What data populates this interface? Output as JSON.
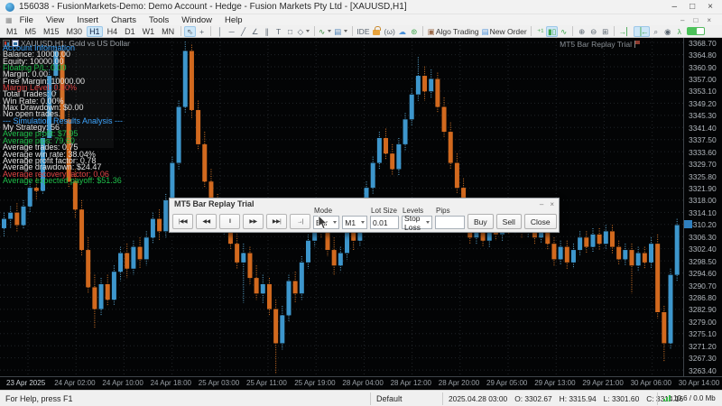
{
  "window": {
    "title": "156038 - FusionMarkets-Demo: Demo Account - Hedge - Fusion Markets Pty Ltd - [XAUUSD,H1]",
    "controls": {
      "minimize": "–",
      "maximize": "□",
      "close": "×"
    }
  },
  "menu": {
    "icon": "▦",
    "items": [
      "File",
      "View",
      "Insert",
      "Charts",
      "Tools",
      "Window",
      "Help"
    ]
  },
  "toolbar": {
    "timeframes": [
      "M1",
      "M5",
      "M15",
      "M30",
      "H1",
      "H4",
      "D1",
      "W1",
      "MN"
    ],
    "active_timeframe": "H1",
    "items": [
      {
        "type": "sep"
      },
      {
        "name": "cursor-tool-button",
        "glyph": "⇖",
        "active": true
      },
      {
        "name": "crosshair-tool-button",
        "glyph": "+"
      },
      {
        "type": "sep"
      },
      {
        "name": "vertical-line-tool-button",
        "glyph": "│"
      },
      {
        "name": "horizontal-line-tool-button",
        "glyph": "─"
      },
      {
        "name": "trendline-tool-button",
        "glyph": "╱"
      },
      {
        "name": "angle-trendline-tool-button",
        "glyph": "∠"
      },
      {
        "name": "equidistant-channel-tool-button",
        "glyph": "∥"
      },
      {
        "name": "text-tool-button",
        "glyph": "T"
      },
      {
        "name": "rectangle-tool-button",
        "glyph": "□"
      },
      {
        "name": "shapes-menu-button",
        "glyph": "◇",
        "caret": true
      },
      {
        "type": "sep"
      },
      {
        "name": "indicators-menu-button",
        "glyph": "∿",
        "color": "#3a8c3f",
        "caret": true
      },
      {
        "name": "templates-menu-button",
        "glyph": "▤",
        "color": "#4a7fb5",
        "caret": true
      },
      {
        "type": "sep"
      },
      {
        "name": "ide-button",
        "glyph": "IDE"
      },
      {
        "name": "lock-icon",
        "css": "lockicon"
      },
      {
        "name": "virtual-hosting-button",
        "glyph": "(ω)"
      },
      {
        "name": "cloud-icon-button",
        "glyph": "☁",
        "color": "#4a90d9"
      },
      {
        "name": "community-icon-button",
        "glyph": "⊛",
        "color": "#3da54a"
      },
      {
        "type": "sep"
      },
      {
        "name": "algo-trading-button",
        "glyph": "▣",
        "color": "#9a6a4a",
        "label": "Algo Trading"
      },
      {
        "name": "new-order-button",
        "glyph": "▤",
        "color": "#4a90d9",
        "label": "New Order"
      },
      {
        "type": "sep"
      },
      {
        "name": "tick-chart-button",
        "glyph": "⁺¹",
        "color": "#3da54a"
      },
      {
        "name": "candle-chart-button",
        "glyph": "▮▯",
        "color": "#3da54a",
        "active": true
      },
      {
        "name": "line-chart-button",
        "glyph": "∿",
        "color": "#3da54a"
      },
      {
        "type": "sep"
      },
      {
        "name": "zoom-in-button",
        "glyph": "⊕"
      },
      {
        "name": "zoom-out-button",
        "glyph": "⊖"
      },
      {
        "name": "tile-windows-button",
        "glyph": "⊞"
      },
      {
        "type": "sep"
      },
      {
        "name": "auto-scroll-button",
        "glyph": "→▏",
        "color": "#3da54a"
      },
      {
        "name": "chart-shift-button",
        "glyph": "▕←",
        "color": "#3da54a",
        "active": true
      },
      {
        "name": "search-icon-button",
        "glyph": "⌕"
      },
      {
        "name": "help-about-button",
        "glyph": "◉"
      },
      {
        "name": "hotkey-walker-button",
        "glyph": "λ",
        "color": "#3da54a"
      },
      {
        "name": "replay-toggle",
        "css": "toggle"
      }
    ]
  },
  "chart": {
    "symbol_label": "XAUUSD,H1:  Gold vs US Dollar",
    "indicator_label": "MT5 Bar Replay Trial",
    "price_marker": "3310.20",
    "colors": {
      "up": "#3d96cc",
      "up_wick": "#5fb0dd",
      "down": "#d2691e",
      "down_wick": "#e07b28",
      "grid": "#212529",
      "accent": "#2f7fbe"
    }
  },
  "overlay": {
    "colors": {
      "w": "#e2e2e2",
      "g": "#1fbf4a",
      "r": "#e04545",
      "b": "#3ea6ff"
    },
    "lines": [
      {
        "t": "Account Information",
        "c": "b"
      },
      {
        "t": "Balance: 10000.00",
        "c": "w"
      },
      {
        "t": "Equity: 10000.00",
        "c": "w"
      },
      {
        "t": "Floating P/L: 0.00",
        "c": "g"
      },
      {
        "t": "Margin: 0.00",
        "c": "w"
      },
      {
        "t": "Free Margin: 10000.00",
        "c": "w"
      },
      {
        "t": "Margin Level: 0.00%",
        "c": "r"
      },
      {
        "t": "Total Trades: 0",
        "c": "w"
      },
      {
        "t": "Win Rate: 0.00%",
        "c": "w"
      },
      {
        "t": "Max Drawdown: $0.00",
        "c": "w"
      },
      {
        "t": "No open trades.",
        "c": "w"
      },
      {
        "t": "--- Simulation Results Analysis ---",
        "c": "b"
      },
      {
        "t": "My Strategy: 56",
        "c": "w"
      },
      {
        "t": "Average profit: $7.95",
        "c": "g"
      },
      {
        "t": "Average pips: 79.60",
        "c": "g"
      },
      {
        "t": "Average trades: 0.75",
        "c": "w"
      },
      {
        "t": "Average win rate: 38.04%",
        "c": "w"
      },
      {
        "t": "Average profit factor: 0.78",
        "c": "w"
      },
      {
        "t": "Average drawdown: $24.47",
        "c": "w"
      },
      {
        "t": "Average recovery factor: 0.06",
        "c": "r"
      },
      {
        "t": "Average expected payoff: $51.36",
        "c": "g"
      }
    ]
  },
  "chart_data": {
    "type": "candlestick",
    "symbol": "XAUUSD",
    "timeframe": "H1",
    "grid": true,
    "ylim": [
      3263.4,
      3368.7
    ],
    "render_ylim": [
      3261.4,
      3370.2
    ],
    "y_ticks": [
      "3368.70",
      "3364.80",
      "3360.90",
      "3357.00",
      "3353.10",
      "3349.20",
      "3345.30",
      "3341.40",
      "3337.50",
      "3333.60",
      "3329.70",
      "3325.80",
      "3321.90",
      "3318.00",
      "3314.10",
      "3310.20",
      "3306.30",
      "3302.40",
      "3298.50",
      "3294.60",
      "3290.70",
      "3286.80",
      "3282.90",
      "3279.00",
      "3275.10",
      "3271.20",
      "3267.30",
      "3263.40"
    ],
    "x_ticks": [
      "23 Apr 2025",
      "24 Apr 02:00",
      "24 Apr 10:00",
      "24 Apr 18:00",
      "25 Apr 03:00",
      "25 Apr 11:00",
      "25 Apr 19:00",
      "28 Apr 04:00",
      "28 Apr 12:00",
      "28 Apr 20:00",
      "29 Apr 05:00",
      "29 Apr 13:00",
      "29 Apr 21:00",
      "30 Apr 06:00",
      "30 Apr 14:00"
    ],
    "candles": [
      [
        3309,
        3314,
        3306,
        3312
      ],
      [
        3312,
        3316,
        3309,
        3314
      ],
      [
        3314,
        3317,
        3308,
        3310
      ],
      [
        3310,
        3318,
        3309,
        3316
      ],
      [
        3316,
        3324,
        3314,
        3322
      ],
      [
        3322,
        3326,
        3318,
        3321
      ],
      [
        3321,
        3340,
        3320,
        3338
      ],
      [
        3338,
        3360,
        3336,
        3358
      ],
      [
        3358,
        3368,
        3352,
        3366
      ],
      [
        3366,
        3369,
        3342,
        3344
      ],
      [
        3344,
        3348,
        3322,
        3324
      ],
      [
        3324,
        3328,
        3312,
        3315
      ],
      [
        3315,
        3318,
        3300,
        3302
      ],
      [
        3302,
        3306,
        3288,
        3290
      ],
      [
        3290,
        3294,
        3277,
        3283
      ],
      [
        3283,
        3293,
        3281,
        3291
      ],
      [
        3291,
        3294,
        3284,
        3286
      ],
      [
        3286,
        3297,
        3284,
        3295
      ],
      [
        3295,
        3303,
        3292,
        3301
      ],
      [
        3301,
        3304,
        3293,
        3296
      ],
      [
        3296,
        3305,
        3294,
        3303
      ],
      [
        3303,
        3306,
        3296,
        3299
      ],
      [
        3299,
        3308,
        3297,
        3306
      ],
      [
        3306,
        3314,
        3304,
        3312
      ],
      [
        3312,
        3315,
        3305,
        3308
      ],
      [
        3308,
        3320,
        3306,
        3318
      ],
      [
        3318,
        3332,
        3316,
        3330
      ],
      [
        3330,
        3350,
        3328,
        3348
      ],
      [
        3348,
        3369,
        3346,
        3366
      ],
      [
        3366,
        3368,
        3344,
        3347
      ],
      [
        3347,
        3350,
        3334,
        3336
      ],
      [
        3336,
        3340,
        3322,
        3324
      ],
      [
        3324,
        3328,
        3314,
        3316
      ],
      [
        3316,
        3320,
        3308,
        3310
      ],
      [
        3310,
        3316,
        3307,
        3313
      ],
      [
        3313,
        3315,
        3302,
        3304
      ],
      [
        3304,
        3308,
        3296,
        3298
      ],
      [
        3298,
        3304,
        3285,
        3301
      ],
      [
        3301,
        3303,
        3291,
        3293
      ],
      [
        3293,
        3297,
        3286,
        3288
      ],
      [
        3288,
        3294,
        3285,
        3291
      ],
      [
        3291,
        3293,
        3281,
        3283
      ],
      [
        3283,
        3286,
        3262,
        3272
      ],
      [
        3272,
        3284,
        3270,
        3281
      ],
      [
        3281,
        3294,
        3279,
        3292
      ],
      [
        3292,
        3295,
        3285,
        3288
      ],
      [
        3288,
        3300,
        3286,
        3298
      ],
      [
        3298,
        3307,
        3296,
        3305
      ],
      [
        3305,
        3314,
        3303,
        3312
      ],
      [
        3312,
        3315,
        3306,
        3308
      ],
      [
        3308,
        3311,
        3300,
        3302
      ],
      [
        3302,
        3306,
        3294,
        3297
      ],
      [
        3297,
        3303,
        3295,
        3301
      ],
      [
        3301,
        3310,
        3299,
        3308
      ],
      [
        3308,
        3311,
        3302,
        3305
      ],
      [
        3305,
        3316,
        3303,
        3314
      ],
      [
        3314,
        3324,
        3312,
        3322
      ],
      [
        3322,
        3332,
        3320,
        3330
      ],
      [
        3330,
        3340,
        3328,
        3338
      ],
      [
        3338,
        3341,
        3331,
        3333
      ],
      [
        3333,
        3336,
        3326,
        3328
      ],
      [
        3328,
        3338,
        3326,
        3336
      ],
      [
        3336,
        3346,
        3334,
        3344
      ],
      [
        3344,
        3354,
        3342,
        3352
      ],
      [
        3352,
        3364,
        3350,
        3358
      ],
      [
        3358,
        3361,
        3350,
        3353
      ],
      [
        3353,
        3360,
        3351,
        3357
      ],
      [
        3357,
        3359,
        3346,
        3348
      ],
      [
        3348,
        3351,
        3338,
        3340
      ],
      [
        3340,
        3343,
        3328,
        3330
      ],
      [
        3330,
        3333,
        3320,
        3322
      ],
      [
        3322,
        3325,
        3311,
        3313
      ],
      [
        3313,
        3316,
        3304,
        3306
      ],
      [
        3306,
        3313,
        3304,
        3311
      ],
      [
        3311,
        3313,
        3303,
        3305
      ],
      [
        3305,
        3312,
        3303,
        3310
      ],
      [
        3310,
        3313,
        3305,
        3307
      ],
      [
        3307,
        3314,
        3305,
        3312
      ],
      [
        3312,
        3314,
        3307,
        3309
      ],
      [
        3309,
        3315,
        3307,
        3313
      ],
      [
        3313,
        3315,
        3306,
        3308
      ],
      [
        3308,
        3313,
        3306,
        3311
      ],
      [
        3311,
        3313,
        3304,
        3306
      ],
      [
        3306,
        3312,
        3304,
        3310
      ],
      [
        3310,
        3312,
        3302,
        3304
      ],
      [
        3304,
        3306,
        3297,
        3299
      ],
      [
        3299,
        3305,
        3297,
        3303
      ],
      [
        3303,
        3305,
        3296,
        3298
      ],
      [
        3298,
        3304,
        3296,
        3302
      ],
      [
        3302,
        3308,
        3300,
        3306
      ],
      [
        3306,
        3308,
        3301,
        3303
      ],
      [
        3303,
        3309,
        3301,
        3307
      ],
      [
        3307,
        3309,
        3302,
        3304
      ],
      [
        3304,
        3310,
        3302,
        3308
      ],
      [
        3308,
        3310,
        3301,
        3303
      ],
      [
        3303,
        3305,
        3297,
        3299
      ],
      [
        3299,
        3304,
        3297,
        3302
      ],
      [
        3302,
        3304,
        3288,
        3297
      ],
      [
        3297,
        3303,
        3295,
        3301
      ],
      [
        3301,
        3303,
        3296,
        3298
      ],
      [
        3298,
        3306,
        3296,
        3304
      ],
      [
        3304,
        3307,
        3280,
        3282
      ],
      [
        3282,
        3284,
        3266,
        3272
      ],
      [
        3272,
        3296,
        3270,
        3294
      ],
      [
        3294,
        3312,
        3292,
        3310
      ]
    ]
  },
  "dialog": {
    "title": "MT5 Bar Replay Trial",
    "minimize": "–",
    "close_icon": "×",
    "playback": [
      {
        "name": "go-to-start-button",
        "glyph": "|◀◀"
      },
      {
        "name": "rewind-button",
        "glyph": "◀◀"
      },
      {
        "name": "pause-button",
        "glyph": "‖"
      },
      {
        "name": "fast-forward-button",
        "glyph": "▶▶"
      },
      {
        "name": "go-to-end-button",
        "glyph": "▶▶|"
      },
      {
        "name": "step-forward-button",
        "glyph": "→|"
      }
    ],
    "fields": {
      "mode_label": "Mode",
      "mode_value": "Bar",
      "tf_value": "M1",
      "lot_label": "Lot Size",
      "lot_value": "0.01",
      "levels_label": "Levels",
      "levels_value": "Stop Loss",
      "pips_label": "Pips",
      "pips_value": ""
    },
    "buy_label": "Buy",
    "sell_label": "Sell",
    "close_label": "Close"
  },
  "statusbar": {
    "help": "For Help, press F1",
    "profile": "Default",
    "bar_time": "2025.04.28 03:00",
    "o": "O: 3302.67",
    "h": "H: 3315.94",
    "l": "L: 3301.60",
    "c": "C: 3314.16",
    "traffic": "10.6 / 0.0 Mb"
  }
}
